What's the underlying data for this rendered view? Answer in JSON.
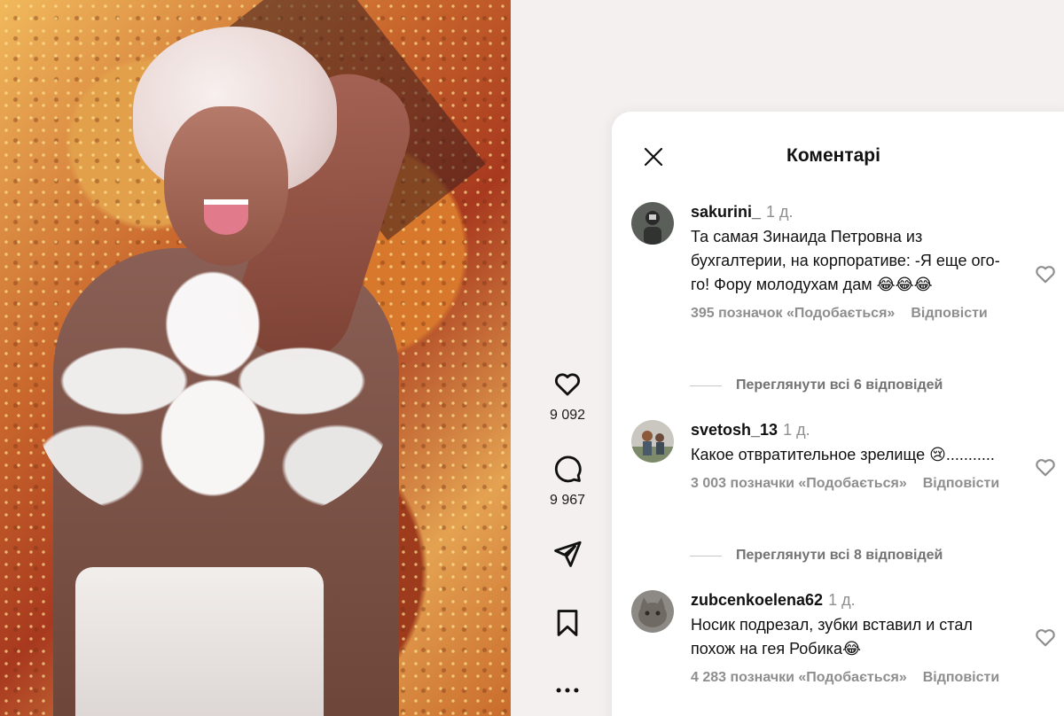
{
  "panel": {
    "title": "Коментарі",
    "close_icon": "close-icon"
  },
  "actions": {
    "likes": "9 092",
    "comments": "9 967"
  },
  "comments": [
    {
      "username": "sakurini_",
      "time": "1 д.",
      "text": "Та самая Зинаида Петровна из бухгалтерии, на корпоративе: -Я еще ого-го! Фору молодухам дам 😂😂😂",
      "likes": "395 позначок «Подобається»",
      "reply": "Відповісти",
      "view_replies": "Переглянути всі 6 відповідей"
    },
    {
      "username": "svetosh_13",
      "time": "1 д.",
      "text": "Какое отвратительное зрелище 😢...........",
      "likes": "3 003 позначки «Подобається»",
      "reply": "Відповісти",
      "view_replies": "Переглянути всі 8 відповідей"
    },
    {
      "username": "zubcenkoelena62",
      "time": "1 д.",
      "text": "Носик подрезал, зубки вставил и стал похож на гея Робика😂",
      "likes": "4 283 позначки «Подобається»",
      "reply": "Відповісти"
    }
  ]
}
